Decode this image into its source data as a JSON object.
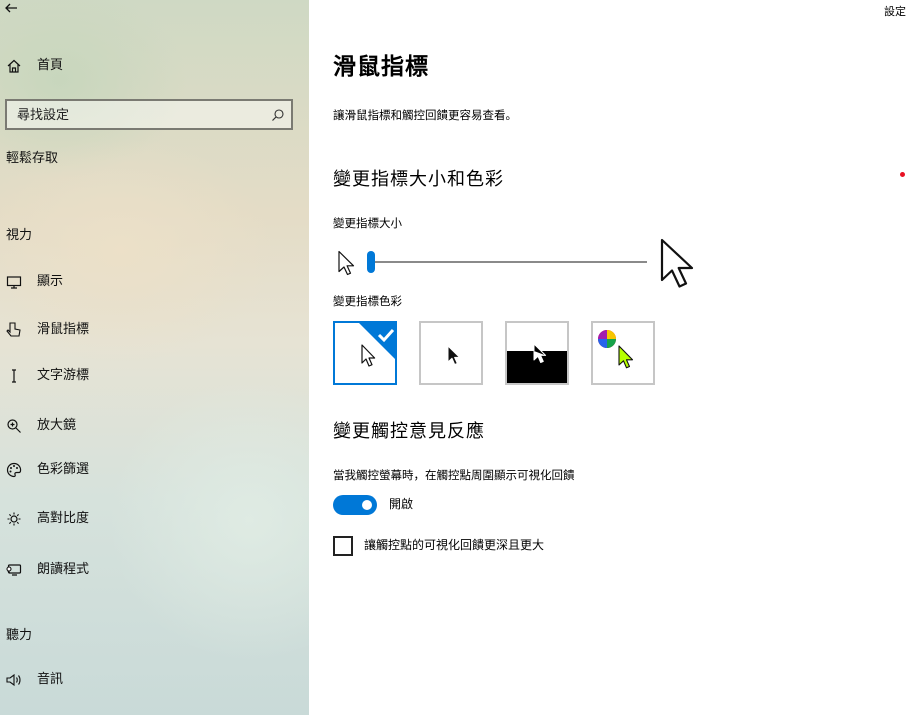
{
  "window": {
    "title": "設定"
  },
  "sidebar": {
    "back_icon": "back-arrow-icon",
    "home_label": "首頁",
    "search": {
      "placeholder": "尋找設定"
    },
    "category_title": "輕鬆存取",
    "vision_section": "視力",
    "hearing_section": "聽力",
    "items": [
      {
        "label": "顯示",
        "icon": "display-icon"
      },
      {
        "label": "滑鼠指標",
        "icon": "mouse-pointer-icon",
        "selected": true
      },
      {
        "label": "文字游標",
        "icon": "text-cursor-icon"
      },
      {
        "label": "放大鏡",
        "icon": "magnifier-icon"
      },
      {
        "label": "色彩篩選",
        "icon": "color-filter-icon"
      },
      {
        "label": "高對比度",
        "icon": "high-contrast-icon"
      },
      {
        "label": "朗讀程式",
        "icon": "narrator-icon"
      },
      {
        "label": "音訊",
        "icon": "audio-icon"
      }
    ]
  },
  "main": {
    "title": "滑鼠指標",
    "description": "讓滑鼠指標和觸控回饋更容易查看。",
    "pointer_section": {
      "heading": "變更指標大小和色彩",
      "size_label": "變更指標大小",
      "size_value": 1,
      "size_min": 1,
      "size_max": 15,
      "color_label": "變更指標色彩",
      "color_options": [
        {
          "name": "white",
          "selected": true
        },
        {
          "name": "black",
          "selected": false
        },
        {
          "name": "inverted",
          "selected": false
        },
        {
          "name": "custom",
          "selected": false
        }
      ]
    },
    "touch_section": {
      "heading": "變更觸控意見反應",
      "feedback_label": "當我觸控螢幕時，在觸控點周圍顯示可視化回饋",
      "toggle_state": "開啟",
      "toggle_on": true,
      "checkbox_label": "讓觸控點的可視化回饋更深且更大",
      "checkbox_checked": false
    }
  },
  "colors": {
    "accent": "#0078d7",
    "notification_dot": "#e81123"
  }
}
